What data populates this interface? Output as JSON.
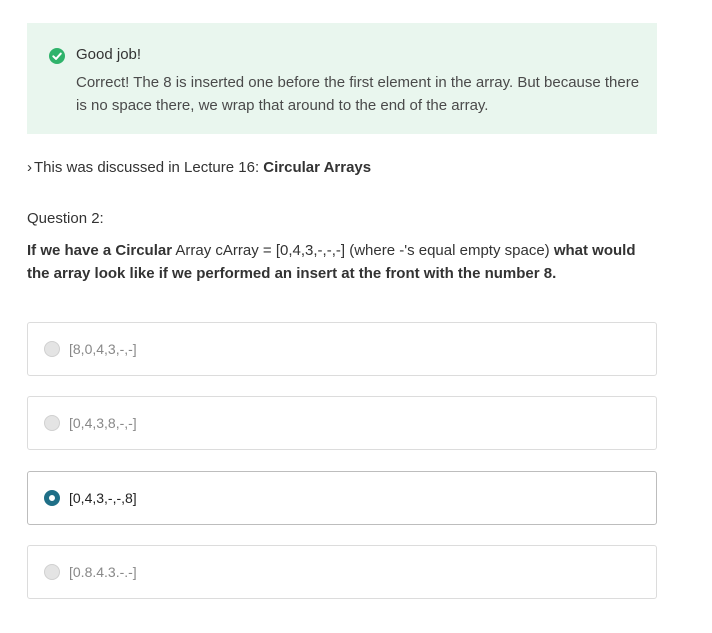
{
  "feedback": {
    "title": "Good job!",
    "body": "Correct! The 8 is inserted one before the first element in the array. But because there is no space there, we wrap that around to the end of the array.",
    "icon": "check-circle-icon",
    "icon_color": "#2fb36b"
  },
  "discussion": {
    "chevron": "›",
    "prefix": "This was discussed in Lecture 16: ",
    "link": "Circular Arrays"
  },
  "question": {
    "label": "Question 2:",
    "part1": "If we have a ",
    "part2": "Circular",
    "part3": " Array cArray = [0,4,3,-,-,-] (where -'s equal empty space)",
    "part4": " what would the array look like if we performed an insert at the ",
    "part5": "front",
    "part6": " with the number 8.",
    "options": [
      {
        "label": "[8,0,4,3,-,-]",
        "selected": false
      },
      {
        "label": "[0,4,3,8,-,-]",
        "selected": false
      },
      {
        "label": "[0,4,3,-,-,8]",
        "selected": true
      },
      {
        "label": "[0.8.4.3.-.-]",
        "selected": false
      }
    ]
  },
  "colors": {
    "feedback_bg": "#e9f6ee",
    "radio_selected": "#1f6f87"
  }
}
